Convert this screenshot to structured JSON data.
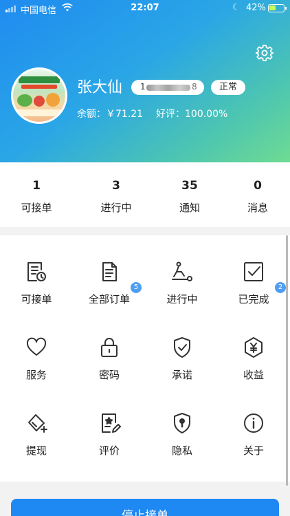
{
  "status_bar": {
    "carrier": "中国电信",
    "time": "22:07",
    "battery": "42%"
  },
  "profile": {
    "name": "张大仙",
    "phone_lead": "1",
    "phone_tail": "8",
    "status_pill": "正常",
    "balance": "余额：￥71.21",
    "rating": "好评：100.00%"
  },
  "stats": [
    {
      "value": "1",
      "label": "可接单"
    },
    {
      "value": "3",
      "label": "进行中"
    },
    {
      "value": "35",
      "label": "通知"
    },
    {
      "value": "0",
      "label": "消息"
    }
  ],
  "menu": [
    {
      "label": "可接单",
      "icon": "order-clock-icon"
    },
    {
      "label": "全部订单",
      "icon": "document-list-icon",
      "badge": "5"
    },
    {
      "label": "进行中",
      "icon": "delivery-rider-icon"
    },
    {
      "label": "已完成",
      "icon": "checkbox-done-icon",
      "badge": "2"
    },
    {
      "label": "服务",
      "icon": "heart-icon"
    },
    {
      "label": "密码",
      "icon": "lock-icon"
    },
    {
      "label": "承诺",
      "icon": "shield-check-icon"
    },
    {
      "label": "收益",
      "icon": "yuan-hexagon-icon"
    },
    {
      "label": "提现",
      "icon": "card-withdraw-icon"
    },
    {
      "label": "评价",
      "icon": "star-review-icon"
    },
    {
      "label": "隐私",
      "icon": "shield-keyhole-icon"
    },
    {
      "label": "关于",
      "icon": "info-circle-icon"
    }
  ],
  "bottom_button": "停止接单",
  "colors": {
    "header_gradient": [
      "#1f8bf0",
      "#6fdb92"
    ],
    "accent": "#1e88f3",
    "badge": "#4f9ef2",
    "icon": "#333333"
  }
}
